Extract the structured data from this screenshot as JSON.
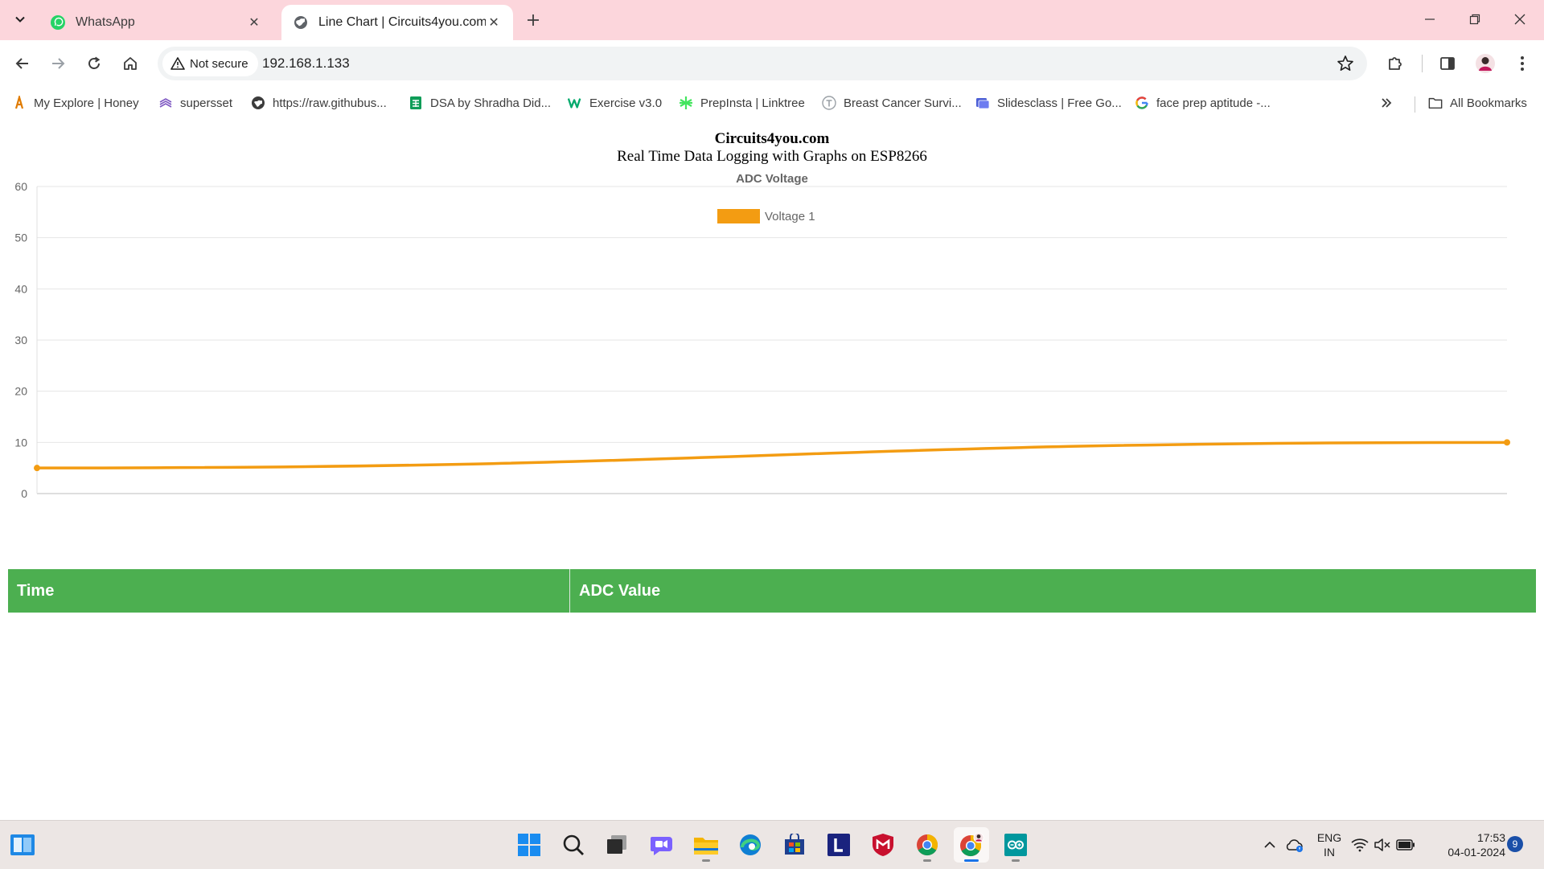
{
  "browser": {
    "tabs": [
      {
        "title": "WhatsApp",
        "active": false,
        "favicon": "whatsapp-icon"
      },
      {
        "title": "Line Chart | Circuits4you.com",
        "active": true,
        "favicon": "globe-icon"
      }
    ],
    "security_label": "Not secure",
    "url": "192.168.1.133",
    "bookmarks": [
      {
        "label": "My Explore | Honey",
        "icon": "honey-icon"
      },
      {
        "label": "supersset",
        "icon": "supersset-icon"
      },
      {
        "label": "https://raw.githubus...",
        "icon": "github-icon"
      },
      {
        "label": "DSA by Shradha Did...",
        "icon": "sheets-icon"
      },
      {
        "label": "Exercise v3.0",
        "icon": "w3schools-icon"
      },
      {
        "label": "PrepInsta | Linktree",
        "icon": "linktree-icon"
      },
      {
        "label": "Breast Cancer Survi...",
        "icon": "t-icon"
      },
      {
        "label": "Slidesclass | Free Go...",
        "icon": "slides-icon"
      },
      {
        "label": "face prep aptitude -...",
        "icon": "google-icon"
      }
    ],
    "all_bookmarks_label": "All Bookmarks"
  },
  "page": {
    "title": "Circuits4you.com",
    "subtitle": "Real Time Data Logging with Graphs on ESP8266",
    "table_headers": [
      "Time",
      "ADC Value"
    ]
  },
  "chart_data": {
    "type": "line",
    "title": "ADC Voltage",
    "xlabel": "",
    "ylabel": "",
    "ylim": [
      0,
      60
    ],
    "yticks": [
      0,
      10,
      20,
      30,
      40,
      50,
      60
    ],
    "grid": true,
    "legend_position": "top",
    "series": [
      {
        "name": "Voltage 1",
        "color": "#f39c12",
        "x": [
          0,
          1
        ],
        "values": [
          5,
          10
        ]
      }
    ]
  },
  "taskbar": {
    "apps": [
      "widgets-icon",
      "start-icon",
      "search-icon",
      "task-view-icon",
      "teams-chat-icon",
      "file-explorer-icon",
      "edge-icon",
      "store-icon",
      "l-app-icon",
      "mcafee-icon",
      "chrome-icon",
      "chrome-profile-icon",
      "arduino-icon"
    ],
    "language_line1": "ENG",
    "language_line2": "IN",
    "time": "17:53",
    "date": "04-01-2024",
    "notification_count": "9"
  }
}
